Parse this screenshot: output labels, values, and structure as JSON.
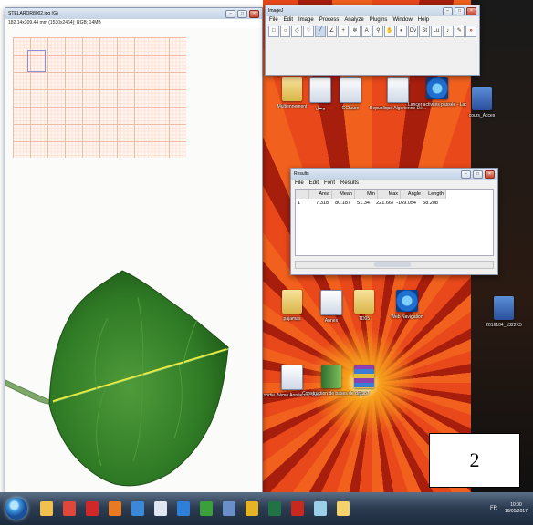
{
  "image_window": {
    "title": "STELAROR8002.jpg (G)",
    "info": "182.14x309.44 mm (1530x2464); RGB; 14MB"
  },
  "imagej": {
    "title": "ImageJ",
    "menu": [
      "File",
      "Edit",
      "Image",
      "Process",
      "Analyze",
      "Plugins",
      "Window",
      "Help"
    ]
  },
  "results": {
    "title": "Results",
    "menu": [
      "File",
      "Edit",
      "Font",
      "Results"
    ],
    "columns": [
      "",
      "Area",
      "Mean",
      "Min",
      "Max",
      "Angle",
      "Length"
    ],
    "rows": [
      [
        "1",
        "7.318",
        "80.187",
        "51.347",
        "221.667",
        "-169.054",
        "58.208"
      ]
    ]
  },
  "desktop_icons": [
    {
      "label": "Multiennement",
      "kind": "folder"
    },
    {
      "label": "ﻭﺻﻞ",
      "kind": "doc"
    },
    {
      "label": "GCfuure",
      "kind": "doc"
    },
    {
      "label": "Republique Algerienne Dé...",
      "kind": "doc"
    },
    {
      "label": "Lancer activités passée - Lacce",
      "kind": "ie"
    },
    {
      "label": "cours_Acces",
      "kind": "pic"
    },
    {
      "label": "pajamas",
      "kind": "folder"
    },
    {
      "label": "Annex",
      "kind": "doc"
    },
    {
      "label": "TD05",
      "kind": "folder"
    },
    {
      "label": "Web Navigation",
      "kind": "ie"
    },
    {
      "label": "2016104_1322K5",
      "kind": "pic"
    },
    {
      "label": "sortie 2ième Année en Sbilo",
      "kind": "doc"
    },
    {
      "label": "Construction de bases de donn...",
      "kind": "book"
    },
    {
      "label": "g387",
      "kind": "rar"
    }
  ],
  "figure_label": "2",
  "taskbar": {
    "apps": [
      {
        "name": "explorer",
        "color": "#f0c050"
      },
      {
        "name": "chrome",
        "color": "#e0463a"
      },
      {
        "name": "opera",
        "color": "#d02828"
      },
      {
        "name": "firefox",
        "color": "#e87a22"
      },
      {
        "name": "network",
        "color": "#3a88d8"
      },
      {
        "name": "doc",
        "color": "#dfe8f2"
      },
      {
        "name": "ie",
        "color": "#2f7fd8"
      },
      {
        "name": "excel-chart",
        "color": "#3aa03a"
      },
      {
        "name": "image-viewer",
        "color": "#6a8fc8"
      },
      {
        "name": "chrome-2",
        "color": "#e6b422"
      },
      {
        "name": "excel",
        "color": "#217346"
      },
      {
        "name": "pdf",
        "color": "#c8281e"
      },
      {
        "name": "paint",
        "color": "#9bcfe8"
      },
      {
        "name": "imagej",
        "color": "#f3d36a"
      }
    ],
    "language": "FR",
    "time": "10:00",
    "date": "16/05/2017"
  }
}
